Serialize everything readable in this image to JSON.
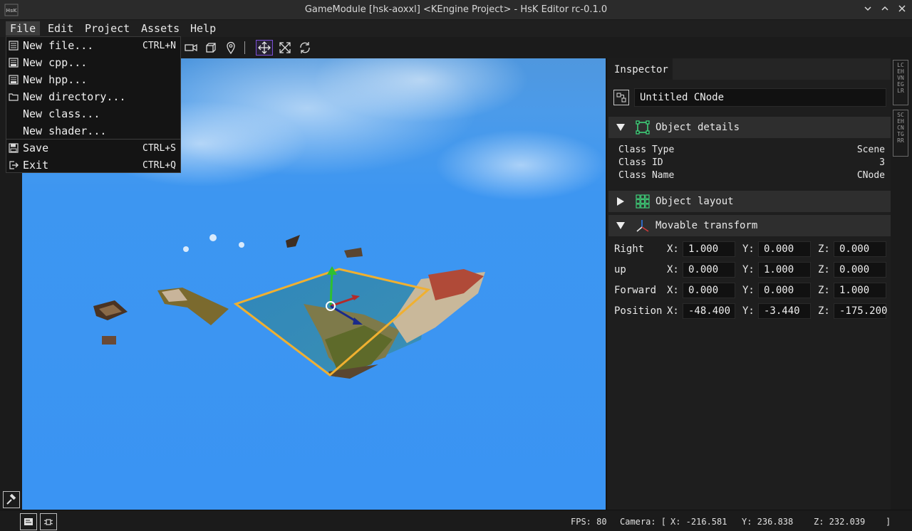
{
  "window": {
    "title": "GameModule [hsk-aoxxl] <KEngine Project> - HsK Editor rc-0.1.0",
    "logo_text": "HsK",
    "controls": [
      "chevron-down",
      "chevron-up",
      "close"
    ]
  },
  "menubar": {
    "items": [
      "File",
      "Edit",
      "Project",
      "Assets",
      "Help"
    ],
    "active": "File"
  },
  "file_menu": {
    "items": [
      {
        "label": "New file...",
        "shortcut": "CTRL+N",
        "icon": "document-icon"
      },
      {
        "label": "New cpp...",
        "shortcut": "",
        "icon": "cpp-file-icon"
      },
      {
        "label": "New hpp...",
        "shortcut": "",
        "icon": "hpp-file-icon"
      },
      {
        "label": "New directory...",
        "shortcut": "",
        "icon": "folder-icon"
      },
      {
        "label": "New class...",
        "shortcut": "",
        "icon": ""
      },
      {
        "label": "New shader...",
        "shortcut": "",
        "icon": ""
      },
      {
        "label": "Save",
        "shortcut": "CTRL+S",
        "icon": "save-icon"
      },
      {
        "label": "Exit",
        "shortcut": "CTRL+Q",
        "icon": "exit-icon"
      }
    ]
  },
  "toolbar": {
    "tools": [
      "camera-icon",
      "cube-icon",
      "location-pin-icon",
      "move-icon",
      "scale-icon",
      "rotate-icon"
    ],
    "selected": "move-icon"
  },
  "inspector": {
    "tab": "Inspector",
    "object_name": "Untitled CNode",
    "object_details": {
      "title": "Object details",
      "expanded": true,
      "rows": [
        {
          "key": "Class Type",
          "value": "Scene"
        },
        {
          "key": "Class ID",
          "value": "3"
        },
        {
          "key": "Class Name",
          "value": "CNode"
        }
      ]
    },
    "object_layout": {
      "title": "Object layout",
      "expanded": false
    },
    "movable_transform": {
      "title": "Movable transform",
      "expanded": true,
      "axis_labels": [
        "X:",
        "Y:",
        "Z:"
      ],
      "rows": [
        {
          "label": "Right",
          "x": "1.000",
          "y": "0.000",
          "z": "0.000"
        },
        {
          "label": "up",
          "x": "0.000",
          "y": "1.000",
          "z": "0.000"
        },
        {
          "label": "Forward",
          "x": "0.000",
          "y": "0.000",
          "z": "1.000"
        },
        {
          "label": "Position",
          "x": "-48.400",
          "y": "-3.440",
          "z": "-175.200"
        }
      ]
    }
  },
  "side_tabs": [
    "LCEHVNEGLR",
    "SCEHCNTGRR"
  ],
  "statusbar": {
    "fps": "FPS: 80",
    "camera_prefix": "Camera: [",
    "camera_x": "X: -216.581",
    "camera_y": "Y: 236.838",
    "camera_z": "Z: 232.039",
    "camera_suffix": "]"
  },
  "colors": {
    "accent_select": "#7b4fd8",
    "sky": "#3a94f3",
    "gizmo_frame": "#f0b030",
    "green_icon": "#3fd17a"
  }
}
